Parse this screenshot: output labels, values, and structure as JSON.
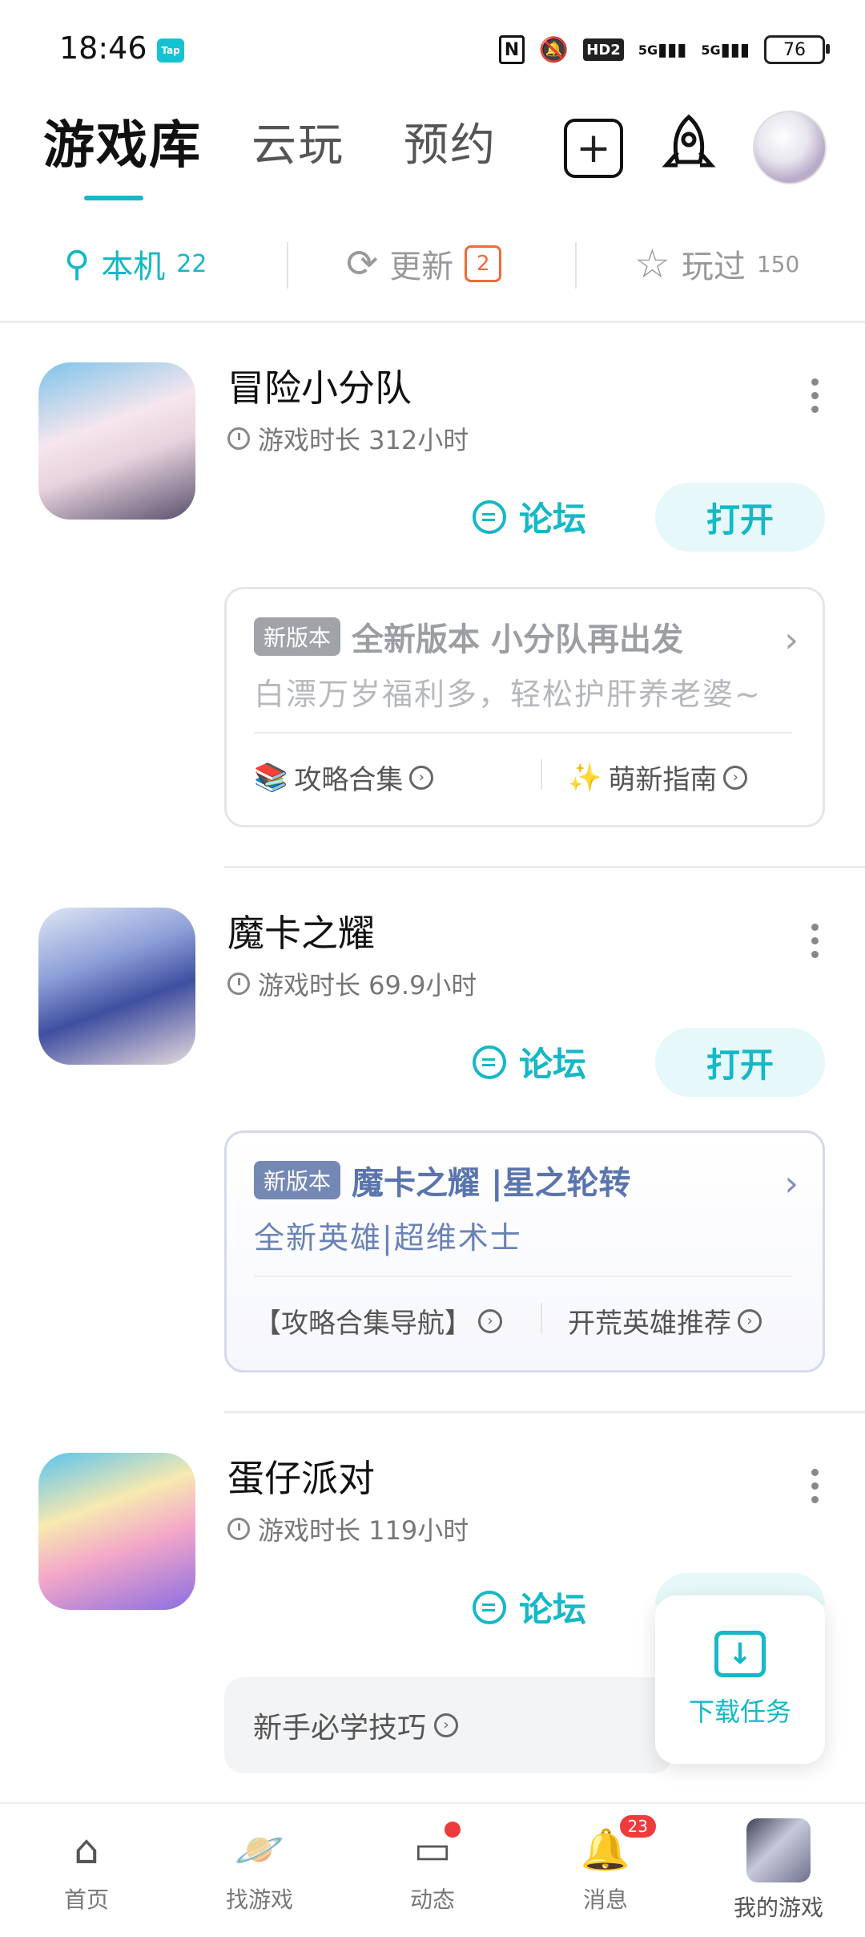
{
  "status_bar": {
    "time": "18:46",
    "tap_badge": "Tap",
    "nfc": "N",
    "hd": "HD2",
    "sim1": "5G",
    "sim2": "5G",
    "battery": "76"
  },
  "top_tabs": {
    "library": "游戏库",
    "cloud": "云玩",
    "reserve": "预约"
  },
  "sub_tabs": {
    "local": "本机",
    "local_count": "22",
    "update": "更新",
    "update_count": "2",
    "played": "玩过",
    "played_count": "150"
  },
  "games": [
    {
      "title": "冒险小分队",
      "duration": "游戏时长 312小时",
      "forum": "论坛",
      "open": "打开",
      "card": {
        "tag": "新版本",
        "title": "全新版本 小分队再出发",
        "subtitle": "白漂万岁福利多，轻松护肝养老婆~",
        "link1": "攻略合集",
        "link2": "萌新指南"
      }
    },
    {
      "title": "魔卡之耀",
      "duration": "游戏时长 69.9小时",
      "forum": "论坛",
      "open": "打开",
      "card": {
        "tag": "新版本",
        "title": "魔卡之耀 |星之轮转",
        "subtitle": "全新英雄|超维术士",
        "link1": "【攻略合集导航】",
        "link2": "开荒英雄推荐"
      }
    },
    {
      "title": "蛋仔派对",
      "duration": "游戏时长 119小时",
      "forum": "论坛",
      "tip": "新手必学技巧"
    }
  ],
  "download_fab": {
    "label": "下载任务"
  },
  "bottom_nav": {
    "home": "首页",
    "find": "找游戏",
    "feed": "动态",
    "messages": "消息",
    "messages_badge": "23",
    "mygames": "我的游戏"
  },
  "colors": {
    "accent": "#14b8c6",
    "update_orange": "#f06a3b",
    "badge_red": "#ef3b3b",
    "tag_blue": "#7488b4"
  }
}
